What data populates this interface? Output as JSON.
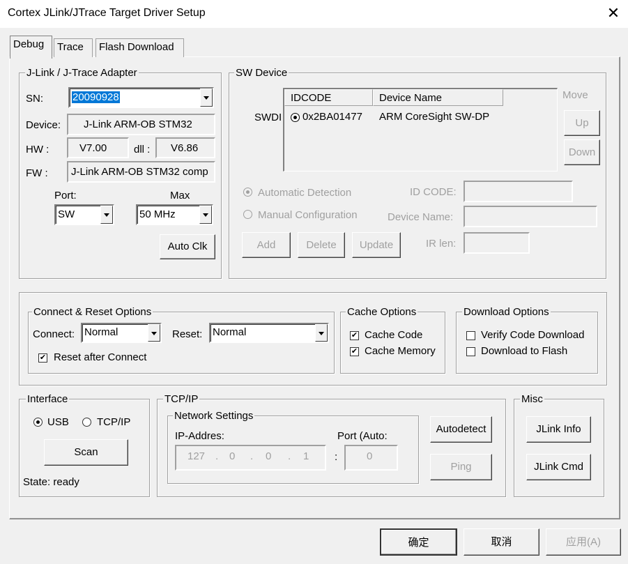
{
  "window": {
    "title": "Cortex JLink/JTrace Target Driver Setup",
    "close_glyph": "✕"
  },
  "tabs": [
    {
      "label": "Debug",
      "active": true
    },
    {
      "label": "Trace",
      "active": false
    },
    {
      "label": "Flash Download",
      "active": false
    }
  ],
  "adapter": {
    "legend": "J-Link / J-Trace Adapter",
    "sn_label": "SN:",
    "sn_value": "20090928",
    "device_label": "Device:",
    "device_value": "J-Link ARM-OB STM32",
    "hw_label": "HW :",
    "hw_value": "V7.00",
    "dll_label": "dll :",
    "dll_value": "V6.86",
    "fw_label": "FW :",
    "fw_value": "J-Link ARM-OB STM32 comp",
    "port_label": "Port:",
    "port_value": "SW",
    "max_label": "Max",
    "max_value": "50 MHz",
    "auto_clk": "Auto Clk"
  },
  "sw_device": {
    "legend": "SW Device",
    "row_label": "SWDI",
    "columns": [
      "IDCODE",
      "Device Name"
    ],
    "rows": [
      {
        "idcode": "0x2BA01477",
        "name": "ARM CoreSight SW-DP",
        "selected": true
      }
    ],
    "move_label": "Move",
    "up": "Up",
    "down": "Down",
    "auto_detect": "Automatic Detection",
    "manual_config": "Manual Configuration",
    "id_code_label": "ID CODE:",
    "device_name_label": "Device Name:",
    "ir_len_label": "IR len:",
    "add": "Add",
    "delete": "Delete",
    "update": "Update"
  },
  "connect_reset": {
    "legend": "Connect & Reset Options",
    "connect_label": "Connect:",
    "connect_value": "Normal",
    "reset_label": "Reset:",
    "reset_value": "Normal",
    "reset_after_connect": "Reset after Connect",
    "reset_after_connect_checked": true
  },
  "cache": {
    "legend": "Cache Options",
    "cache_code": "Cache Code",
    "cache_code_checked": true,
    "cache_memory": "Cache Memory",
    "cache_memory_checked": true
  },
  "download": {
    "legend": "Download Options",
    "verify": "Verify Code Download",
    "verify_checked": false,
    "to_flash": "Download to Flash",
    "to_flash_checked": false
  },
  "interface": {
    "legend": "Interface",
    "usb": "USB",
    "tcpip": "TCP/IP",
    "scan": "Scan",
    "state": "State: ready"
  },
  "tcpip": {
    "legend": "TCP/IP",
    "network_legend": "Network Settings",
    "ip_label": "IP-Addres:",
    "ip_octets": [
      "127",
      "0",
      "0",
      "1"
    ],
    "ip_dot": ".",
    "port_label": "Port (Auto:",
    "colon": ":",
    "port_value": "0",
    "autodetect": "Autodetect",
    "ping": "Ping"
  },
  "misc": {
    "legend": "Misc",
    "jlink_info": "JLink Info",
    "jlink_cmd": "JLink Cmd"
  },
  "footer": {
    "ok": "确定",
    "cancel": "取消",
    "apply": "应用(A)"
  }
}
